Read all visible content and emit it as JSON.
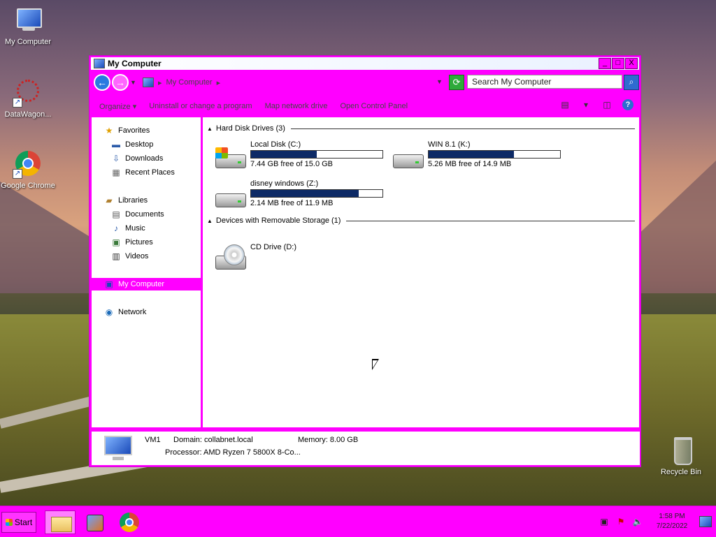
{
  "desktop": {
    "icons": [
      {
        "label": "My Computer"
      },
      {
        "label": "DataWagon..."
      },
      {
        "label": "Google Chrome"
      },
      {
        "label": "Recycle Bin"
      }
    ]
  },
  "window": {
    "title": "My Computer",
    "buttons": {
      "minimize": "_",
      "maximize": "□",
      "close": "X"
    },
    "address": {
      "location": "My Computer",
      "chevron": "▸"
    },
    "search": {
      "placeholder": "Search My Computer"
    },
    "toolbar": {
      "organize": "Organize",
      "uninstall": "Uninstall or change a program",
      "map_drive": "Map network drive",
      "control_panel": "Open Control Panel"
    },
    "nav": {
      "favorites": "Favorites",
      "desktop": "Desktop",
      "downloads": "Downloads",
      "recent": "Recent Places",
      "libraries": "Libraries",
      "documents": "Documents",
      "music": "Music",
      "pictures": "Pictures",
      "videos": "Videos",
      "computer": "My Computer",
      "network": "Network"
    },
    "groups": {
      "hdd": "Hard Disk Drives (3)",
      "removable": "Devices with Removable Storage (1)"
    },
    "drives": [
      {
        "name": "Local Disk (C:)",
        "free": "7.44 GB free of 15.0 GB",
        "used_fraction": 0.5
      },
      {
        "name": "WIN 8.1 (K:)",
        "free": "5.26 MB free of 14.9 MB",
        "used_fraction": 0.65
      },
      {
        "name": "disney windows (Z:)",
        "free": "2.14 MB free of 11.9 MB",
        "used_fraction": 0.82
      }
    ],
    "cd_drive": {
      "name": "CD Drive (D:)"
    },
    "details": {
      "name": "VM1",
      "domain": "Domain: collabnet.local",
      "memory": "Memory: 8.00 GB",
      "processor": "Processor: AMD Ryzen 7 5800X 8-Co..."
    }
  },
  "taskbar": {
    "start": "Start",
    "time": "1:58 PM",
    "date": "7/22/2022"
  }
}
